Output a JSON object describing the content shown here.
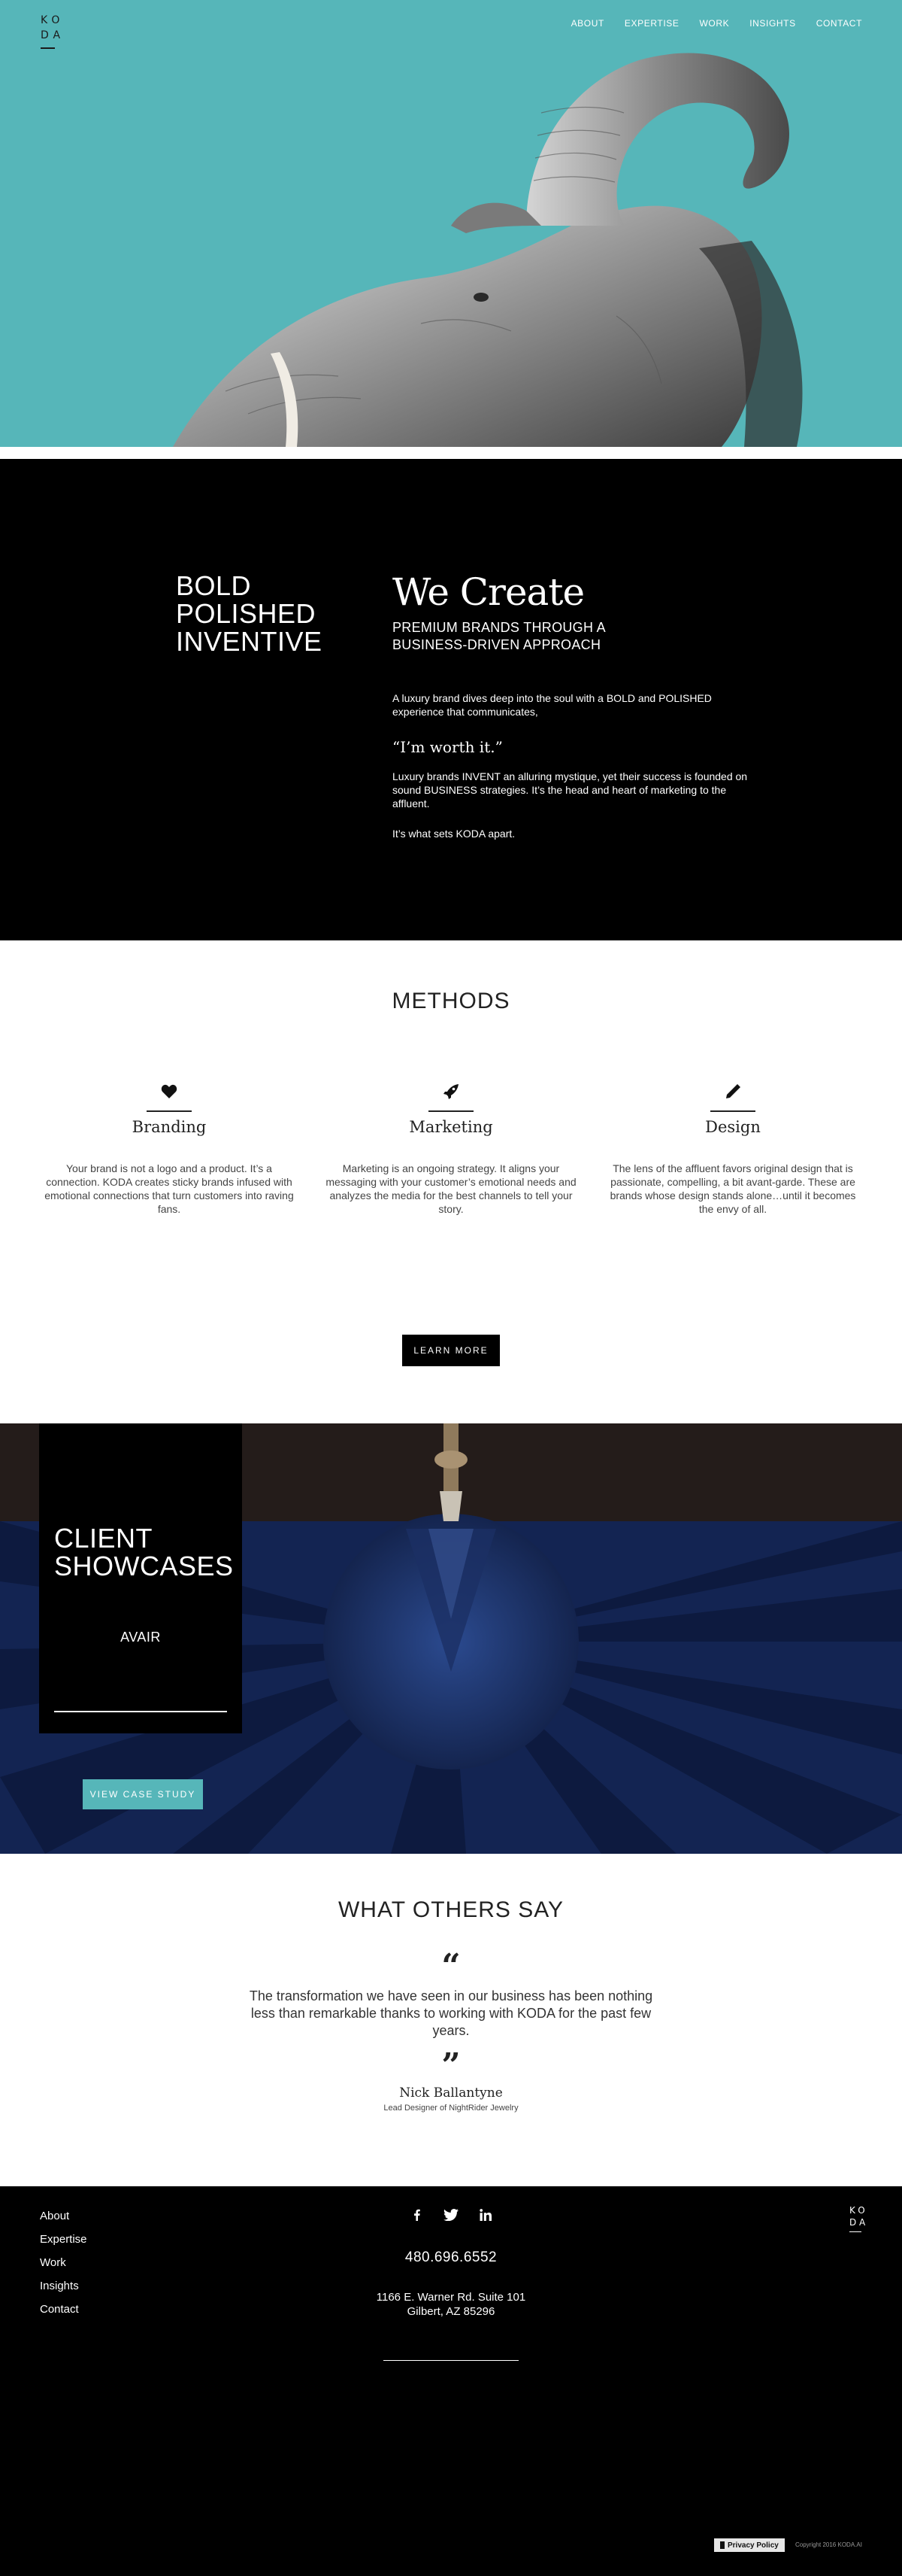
{
  "brand": {
    "logo_top": "KO",
    "logo_bottom": "DA",
    "accent_color": "#56b6b9"
  },
  "nav": {
    "items": [
      {
        "label": "ABOUT"
      },
      {
        "label": "EXPERTISE"
      },
      {
        "label": "WORK"
      },
      {
        "label": "INSIGHTS"
      },
      {
        "label": "CONTACT"
      }
    ]
  },
  "hero": {
    "image": "elephant-image"
  },
  "create": {
    "left_lines": [
      "BOLD",
      "POLISHED",
      "INVENTIVE"
    ],
    "title": "We Create",
    "subtitle_line1": "PREMIUM BRANDS THROUGH A",
    "subtitle_line2": "BUSINESS-DRIVEN APPROACH",
    "paragraph1": "A luxury brand dives deep into the soul with a BOLD and POLISHED experience that communicates,",
    "quote": "“I’m worth it.”",
    "paragraph2": "Luxury brands INVENT an alluring mystique, yet their success is founded on sound BUSINESS strategies. It’s the head and heart of marketing to the affluent.",
    "paragraph3": "It’s what sets KODA apart."
  },
  "methods": {
    "title": "METHODS",
    "items": [
      {
        "icon": "heart-icon",
        "name": "Branding",
        "text": "Your brand is not a logo and a product. It’s a connection. KODA creates sticky brands infused with emotional connections that turn customers into raving fans."
      },
      {
        "icon": "rocket-icon",
        "name": "Marketing",
        "text": "Marketing is an ongoing strategy. It aligns your messaging with your customer’s emotional needs and analyzes the media for the best channels to tell your story."
      },
      {
        "icon": "pencil-icon",
        "name": "Design",
        "text": "The lens of the affluent favors original design that is passionate, compelling, a bit avant-garde. These are brands whose design stands alone…until it becomes the envy of all."
      }
    ],
    "cta": "LEARN MORE"
  },
  "showcase": {
    "title_line1": "CLIENT",
    "title_line2": "SHOWCASES",
    "client": "AVAIR",
    "cta": "VIEW CASE STUDY"
  },
  "testimonial": {
    "title": "WHAT OTHERS SAY",
    "open_mark": "“",
    "close_mark": "”",
    "quote": "The transformation we have seen in our business has been nothing less than remarkable thanks to working with KODA for the past few years.",
    "author": "Nick Ballantyne",
    "role": "Lead Designer of NightRider Jewelry"
  },
  "footer": {
    "links": [
      {
        "label": "About"
      },
      {
        "label": "Expertise"
      },
      {
        "label": "Work"
      },
      {
        "label": "Insights"
      },
      {
        "label": "Contact"
      }
    ],
    "social": [
      "facebook-icon",
      "twitter-icon",
      "linkedin-icon"
    ],
    "phone": "480.696.6552",
    "address_line1": "1166 E. Warner Rd. Suite 101",
    "address_line2": "Gilbert, AZ 85296",
    "privacy": "Privacy Policy",
    "copyright": "Copyright 2016 KODA.AI"
  }
}
